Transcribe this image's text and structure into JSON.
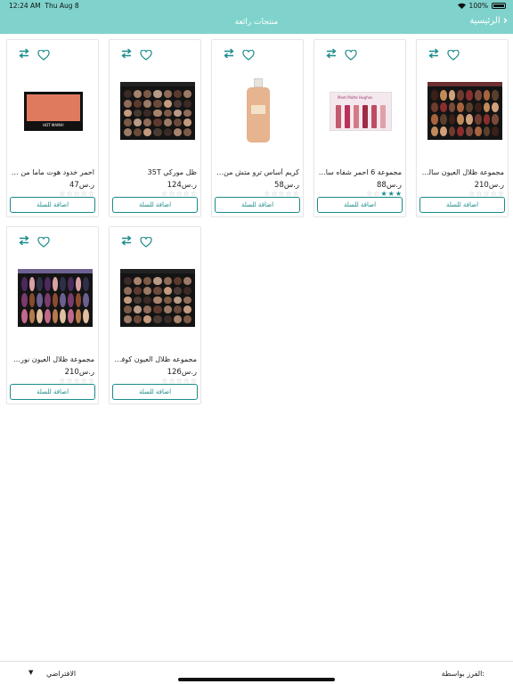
{
  "status": {
    "time": "12:24 AM",
    "date": "Thu Aug 8",
    "battery": "100%"
  },
  "nav": {
    "title": "منتجات رائعة",
    "back_label": "الرئيسية"
  },
  "common": {
    "add_to_cart": "اضافة للسلة",
    "currency": "ر.س"
  },
  "products": [
    {
      "name": "مجموعة ظلال العيون سالتري ...",
      "price": "ر.س210",
      "rating": 0
    },
    {
      "name": "مجموعة 6 احمر شفاه سائل مر ..",
      "price": "ر.س88",
      "rating": 3
    },
    {
      "name": "كريم أساس ترو متش من - لوريا...",
      "price": "ر.س58",
      "rating": 0
    },
    {
      "name": "ظل موركي 35T",
      "price": "ر.س124",
      "rating": 0
    },
    {
      "name": "احمر خدود هوت ماما من ذا بالم",
      "price": "ر.س47",
      "rating": 0
    },
    {
      "name": "مجموعه ظلال العيون كوفى م...",
      "price": "ر.س126",
      "rating": 0
    },
    {
      "name": "مجموعة ظلال العيون نورفينا م...",
      "price": "ر.س210",
      "rating": 0
    }
  ],
  "sort": {
    "label": "الفرز بواسطة:",
    "value": "الافتراضي"
  },
  "colors": {
    "header": "#7fd3cc",
    "accent": "#1a8b8b"
  },
  "icons": {
    "favorite": "heart-icon",
    "compare": "compare-arrows-icon",
    "back": "chevron-right-icon",
    "dropdown": "caret-down-icon"
  }
}
